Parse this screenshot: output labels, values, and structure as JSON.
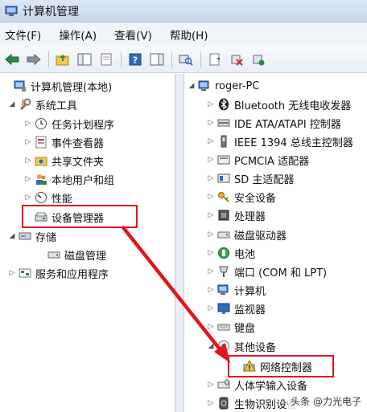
{
  "window": {
    "title": "计算机管理"
  },
  "menu": [
    "文件(F)",
    "操作(A)",
    "查看(V)",
    "帮助(H)"
  ],
  "left_tree": [
    {
      "label": "计算机管理(本地)",
      "icon": "computer-mgmt-icon",
      "expander": ""
    },
    {
      "label": "系统工具",
      "icon": "tools-icon",
      "expander": "◢"
    },
    {
      "label": "任务计划程序",
      "icon": "clock-icon",
      "expander": "▷"
    },
    {
      "label": "事件查看器",
      "icon": "event-viewer-icon",
      "expander": "▷"
    },
    {
      "label": "共享文件夹",
      "icon": "shared-folder-icon",
      "expander": "▷"
    },
    {
      "label": "本地用户和组",
      "icon": "users-icon",
      "expander": "▷"
    },
    {
      "label": "性能",
      "icon": "performance-icon",
      "expander": "▷"
    },
    {
      "label": "设备管理器",
      "icon": "device-manager-icon",
      "expander": ""
    },
    {
      "label": "存储",
      "icon": "storage-icon",
      "expander": "◢"
    },
    {
      "label": "磁盘管理",
      "icon": "disk-icon",
      "expander": ""
    },
    {
      "label": "服务和应用程序",
      "icon": "services-icon",
      "expander": "▷"
    }
  ],
  "right_tree": [
    {
      "label": "roger-PC",
      "icon": "pc-icon",
      "expander": "◢"
    },
    {
      "label": "Bluetooth 无线电收发器",
      "icon": "bluetooth-icon",
      "expander": "▷"
    },
    {
      "label": "IDE ATA/ATAPI 控制器",
      "icon": "ide-icon",
      "expander": "▷"
    },
    {
      "label": "IEEE 1394 总线主控制器",
      "icon": "firewire-icon",
      "expander": "▷"
    },
    {
      "label": "PCMCIA 适配器",
      "icon": "pcmcia-icon",
      "expander": "▷"
    },
    {
      "label": "SD 主适配器",
      "icon": "sd-icon",
      "expander": "▷"
    },
    {
      "label": "安全设备",
      "icon": "security-key-icon",
      "expander": "▷"
    },
    {
      "label": "处理器",
      "icon": "cpu-icon",
      "expander": "▷"
    },
    {
      "label": "磁盘驱动器",
      "icon": "disk-drive-icon",
      "expander": "▷"
    },
    {
      "label": "电池",
      "icon": "battery-icon",
      "expander": "▷"
    },
    {
      "label": "端口 (COM 和 LPT)",
      "icon": "port-icon",
      "expander": "▷"
    },
    {
      "label": "计算机",
      "icon": "computer-icon",
      "expander": "▷"
    },
    {
      "label": "监视器",
      "icon": "monitor-icon",
      "expander": "▷"
    },
    {
      "label": "键盘",
      "icon": "keyboard-icon",
      "expander": "▷"
    },
    {
      "label": "其他设备",
      "icon": "other-devices-icon",
      "expander": "◢"
    },
    {
      "label": "网络控制器",
      "icon": "warning-device-icon",
      "expander": ""
    },
    {
      "label": "人体学输入设备",
      "icon": "hid-icon",
      "expander": "▷"
    },
    {
      "label": "生物识别设备",
      "icon": "biometric-icon",
      "expander": "▷"
    }
  ],
  "watermark": "头条 @力光电子",
  "colors": {
    "highlight": "#e3141c",
    "accent": "#2b6cc4"
  }
}
